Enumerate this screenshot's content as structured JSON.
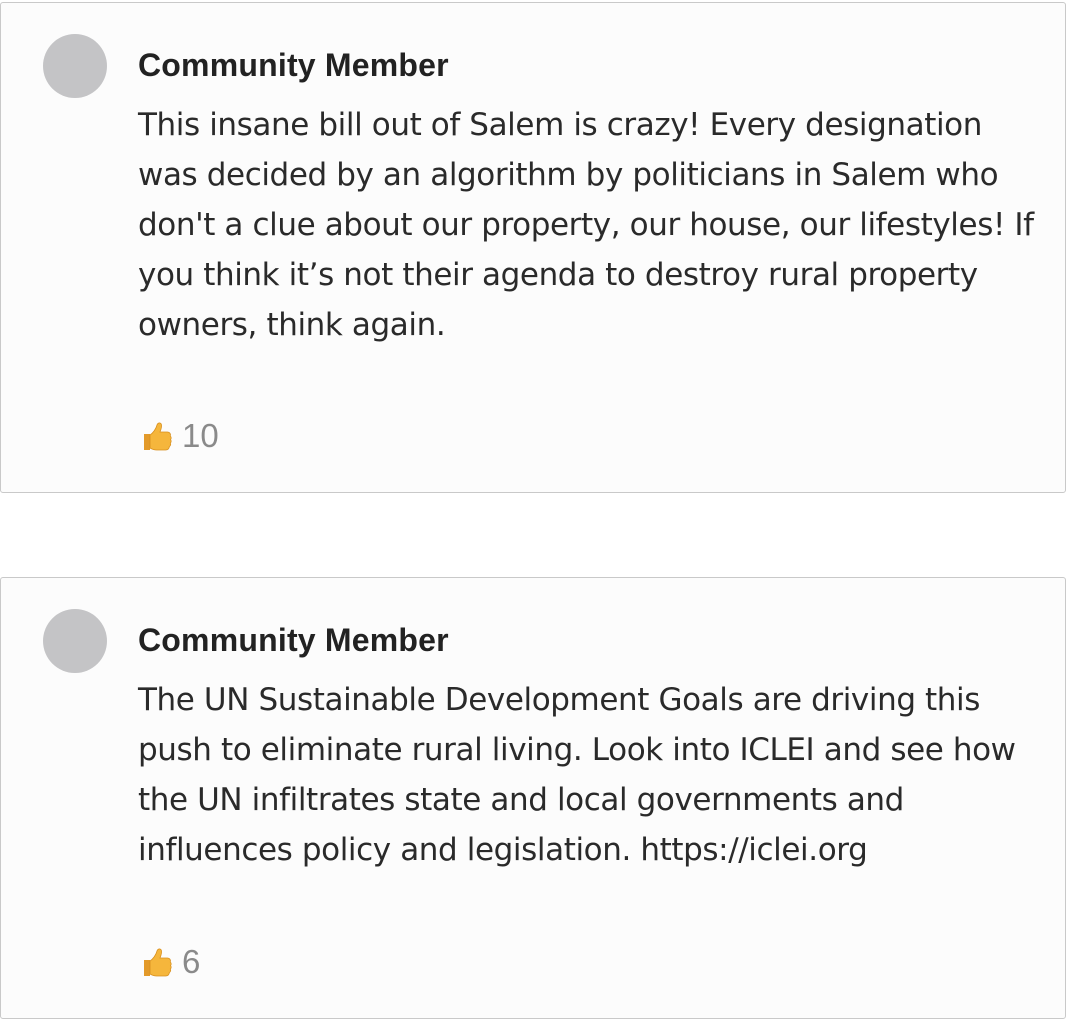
{
  "comments": [
    {
      "author": "Community Member",
      "text": "This insane bill out of Salem is crazy! Every designation was decided by an algorithm by politicians in Salem who don't a clue about our property, our house, our lifestyles! If you think it’s not their agenda to destroy rural property owners, think again.",
      "reaction_icon": "thumbs-up-icon",
      "reaction_count": "10"
    },
    {
      "author": "Community Member",
      "text": "The UN Sustainable Development Goals are driving this push to eliminate rural living. Look into ICLEI and see how the UN infiltrates state and local governments and influences policy and legislation. https://iclei.org",
      "reaction_icon": "thumbs-up-icon",
      "reaction_count": "6"
    }
  ],
  "colors": {
    "avatar": "#c4c4c6",
    "card_border": "#c9c9c9",
    "text": "#2a2a2a",
    "count": "#8a8a8a",
    "thumb": "#f5b63c"
  }
}
